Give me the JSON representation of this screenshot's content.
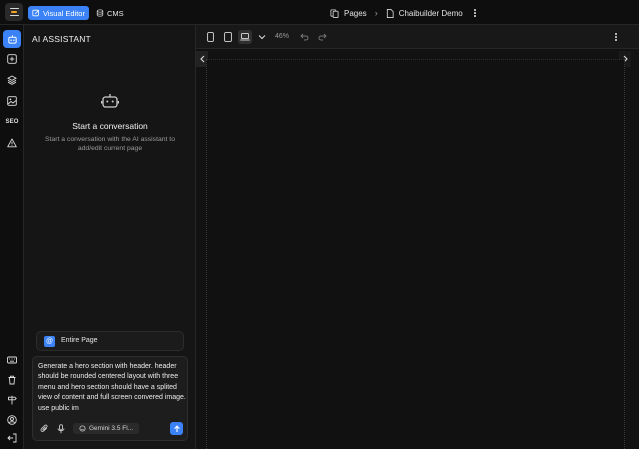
{
  "topbar": {
    "tabs": [
      {
        "label": "Visual Editor",
        "icon": "edit-square-icon",
        "active": true
      },
      {
        "label": "CMS",
        "icon": "database-icon",
        "active": false
      }
    ],
    "breadcrumb": {
      "pages_label": "Pages",
      "page_name": "Chaibuilder Demo"
    }
  },
  "sidebar": {
    "items": [
      {
        "name": "ai-assistant",
        "icon": "robot-icon",
        "active": true
      },
      {
        "name": "add-block",
        "icon": "plus-square-icon"
      },
      {
        "name": "layers",
        "icon": "layers-icon"
      },
      {
        "name": "images",
        "icon": "image-icon"
      },
      {
        "name": "seo",
        "label": "SEO"
      },
      {
        "name": "warnings",
        "icon": "warning-icon"
      }
    ],
    "bottom_items": [
      {
        "name": "keyboard",
        "icon": "keyboard-icon"
      },
      {
        "name": "trash",
        "icon": "trash-icon"
      },
      {
        "name": "signpost",
        "icon": "signpost-icon"
      },
      {
        "name": "account",
        "icon": "user-circle-icon"
      },
      {
        "name": "logout",
        "icon": "logout-icon"
      }
    ]
  },
  "ai_panel": {
    "title": "AI ASSISTANT",
    "empty_state": {
      "title": "Start a conversation",
      "subtitle": "Start a conversation with the AI assistant to add/edit current page"
    },
    "context": {
      "badge": "@",
      "label": "Entire Page"
    },
    "prompt_text": "Generate a hero section with header. header should be rounded centered layout with three menu and hero section should have a splited view of content and full screen convered image. use public im",
    "model_label": "Gemini 3.5 Fl..."
  },
  "canvas_toolbar": {
    "zoom": "46%",
    "viewports": [
      "mobile",
      "tablet",
      "desktop"
    ],
    "selected_viewport": "desktop"
  },
  "colors": {
    "accent": "#3b82f6",
    "background": "#0c0c0c",
    "panel": "#151515"
  }
}
